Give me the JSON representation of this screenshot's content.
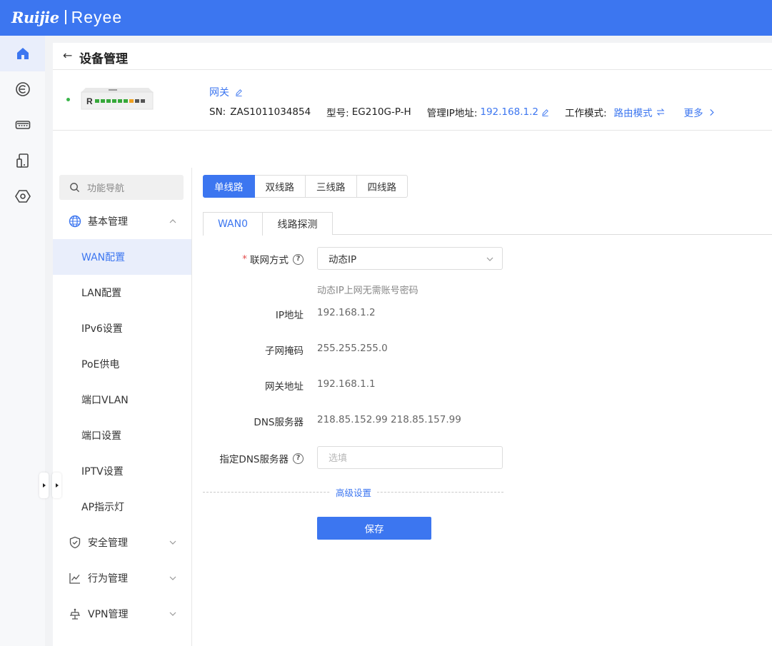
{
  "brand": {
    "name": "Ruijie",
    "product": "Reyee"
  },
  "rail": [
    "home-icon",
    "cloud-icon",
    "switch-icon",
    "device-icon",
    "settings-icon"
  ],
  "header": {
    "back_label": "←",
    "title": "设备管理"
  },
  "device": {
    "name": "网关",
    "sn_label": "SN:",
    "sn": "ZAS1011034854",
    "model_label": "型号:",
    "model": "EG210G-P-H",
    "ip_label": "管理IP地址:",
    "ip": "192.168.1.2",
    "mode_label": "工作模式:",
    "mode": "路由模式",
    "more": "更多"
  },
  "nav": {
    "search_placeholder": "功能导航",
    "groups": [
      {
        "label": "基本管理",
        "icon": "globe-icon"
      },
      {
        "label": "安全管理",
        "icon": "shield-icon"
      },
      {
        "label": "行为管理",
        "icon": "chart-icon"
      },
      {
        "label": "VPN管理",
        "icon": "vpn-icon"
      }
    ],
    "items": [
      "WAN配置",
      "LAN配置",
      "IPv6设置",
      "PoE供电",
      "端口VLAN",
      "端口设置",
      "IPTV设置",
      "AP指示灯"
    ]
  },
  "line_tabs": [
    "单线路",
    "双线路",
    "三线路",
    "四线路"
  ],
  "wan_tabs": [
    "WAN0",
    "线路探测"
  ],
  "form": {
    "conn_label": "联网方式",
    "conn_value": "动态IP",
    "conn_hint": "动态IP上网无需账号密码",
    "ip_label": "IP地址",
    "ip_value": "192.168.1.2",
    "mask_label": "子网掩码",
    "mask_value": "255.255.255.0",
    "gw_label": "网关地址",
    "gw_value": "192.168.1.1",
    "dns_label": "DNS服务器",
    "dns_value": "218.85.152.99 218.85.157.99",
    "custom_dns_label": "指定DNS服务器",
    "custom_dns_placeholder": "选填",
    "advanced": "高级设置",
    "save": "保存"
  },
  "colors": {
    "primary": "#3c76f0",
    "required": "#e34d4d",
    "online": "#3ab54a"
  }
}
